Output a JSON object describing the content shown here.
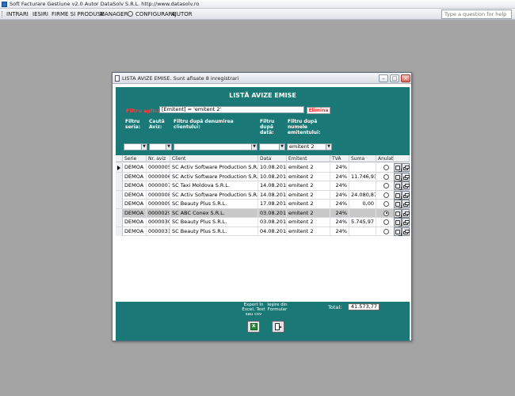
{
  "app": {
    "title": "Soft Facturare Gestiune v2.0 Autor DataSolv S.R.L. http://www.datasolv.ro",
    "help_placeholder": "Type a question for help"
  },
  "menu": [
    "INTRARI",
    "IESIRI",
    "FIRME SI PRODUSE",
    "MANAGER",
    "CONFIGURARE",
    "AJUTOR"
  ],
  "dialog": {
    "title": "LISTA AVIZE EMISE. Sunt afisate 8 inregistrari",
    "heading": "LISTĂ AVIZE EMISE",
    "filter_label": "Filtru aplicat:",
    "filter_value": "[Emitent] = 'emitent 2'",
    "remove_filter": "Elimina",
    "filter_labels": {
      "seria": "Filtru seria:",
      "aviz": "Caută Aviz:",
      "client": "Filtru după denumirea clientului:",
      "data": "Filtru după dată:",
      "emitent": "Filtru după numele emitentului:"
    },
    "filter_values": {
      "seria": "",
      "aviz": "",
      "client": "",
      "data": "",
      "emitent": "emitent 2"
    },
    "columns": [
      "Serie",
      "Nr. aviz",
      "Client",
      "Data",
      "Emitent",
      "TVA",
      "Suma",
      "Anulat"
    ],
    "rows": [
      {
        "serie": "DEMOA",
        "nr": "0000005",
        "client": "SC Activ Software Production S.R.L.",
        "data": "10.08.2012",
        "emitent": "emitent 2",
        "tva": "24%",
        "suma": "",
        "anulat": false
      },
      {
        "serie": "DEMOA",
        "nr": "0000006",
        "client": "SC Activ Software Production S.R.L.",
        "data": "10.08.2012",
        "emitent": "emitent 2",
        "tva": "24%",
        "suma": "11.746,93",
        "anulat": false
      },
      {
        "serie": "DEMOA",
        "nr": "0000007",
        "client": "SC Taxi Moldova S.R.L.",
        "data": "14.08.2012",
        "emitent": "emitent 2",
        "tva": "24%",
        "suma": "",
        "anulat": false
      },
      {
        "serie": "DEMOA",
        "nr": "0000008",
        "client": "SC Activ Software Production S.R.L.",
        "data": "14.08.2012",
        "emitent": "emitent 2",
        "tva": "24%",
        "suma": "24.080,87",
        "anulat": false
      },
      {
        "serie": "DEMOA",
        "nr": "0000009",
        "client": "SC Beauty Plus S.R.L.",
        "data": "17.08.2012",
        "emitent": "emitent 2",
        "tva": "24%",
        "suma": "0,00",
        "anulat": false
      },
      {
        "serie": "DEMOA",
        "nr": "0000029",
        "client": "SC ABC Conex S.R.L.",
        "data": "03.08.2012",
        "emitent": "emitent 2",
        "tva": "24%",
        "suma": "",
        "anulat": true
      },
      {
        "serie": "DEMOA",
        "nr": "0000030",
        "client": "SC Beauty Plus S.R.L.",
        "data": "03.08.2012",
        "emitent": "emitent 2",
        "tva": "24%",
        "suma": "5.745,97",
        "anulat": false
      },
      {
        "serie": "DEMOA",
        "nr": "0000031",
        "client": "SC Beauty Plus S.R.L.",
        "data": "04.08.2012",
        "emitent": "emitent 2",
        "tva": "24%",
        "suma": "",
        "anulat": false
      }
    ],
    "footer": {
      "export_label": "Export în\nExcel, Text\nsau csv",
      "exit_label": "Ieşire din\nFormular",
      "total_label": "Total:",
      "total_value": "41.573,77"
    }
  },
  "colors": {
    "teal": "#1a7977",
    "selected_row": "#c8c8c8",
    "filter_red": "#ff3b3b"
  }
}
